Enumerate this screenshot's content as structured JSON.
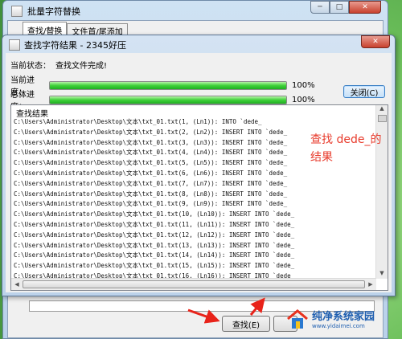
{
  "main_window": {
    "title": "批量字符替换",
    "tabs": [
      "查找/替换",
      "文件首/尾添加"
    ],
    "find_button_label": "查找(E)"
  },
  "dialog": {
    "title": "查找字符结果 - 2345好压",
    "status_label": "当前状态：",
    "status_value": "查找文件完成!",
    "current_progress_label": "当前进度：",
    "current_progress_value": 1.0,
    "current_progress_text": "100%",
    "total_progress_label": "总体进度：",
    "total_progress_value": 1.0,
    "total_progress_text": "100%",
    "close_button_label": "关闭(C)",
    "results_header": "查找结果",
    "results": [
      "C:\\Users\\Administrator\\Desktop\\文本\\txt_01.txt(1, (Ln1)): INTO `dede_",
      "C:\\Users\\Administrator\\Desktop\\文本\\txt_01.txt(2, (Ln2)): INSERT INTO `dede_",
      "C:\\Users\\Administrator\\Desktop\\文本\\txt_01.txt(3, (Ln3)): INSERT INTO `dede_",
      "C:\\Users\\Administrator\\Desktop\\文本\\txt_01.txt(4, (Ln4)): INSERT INTO `dede_",
      "C:\\Users\\Administrator\\Desktop\\文本\\txt_01.txt(5, (Ln5)): INSERT INTO `dede_",
      "C:\\Users\\Administrator\\Desktop\\文本\\txt_01.txt(6, (Ln6)): INSERT INTO `dede_",
      "C:\\Users\\Administrator\\Desktop\\文本\\txt_01.txt(7, (Ln7)): INSERT INTO `dede_",
      "C:\\Users\\Administrator\\Desktop\\文本\\txt_01.txt(8, (Ln8)): INSERT INTO `dede_",
      "C:\\Users\\Administrator\\Desktop\\文本\\txt_01.txt(9, (Ln9)): INSERT INTO `dede_",
      "C:\\Users\\Administrator\\Desktop\\文本\\txt_01.txt(10, (Ln10)): INSERT INTO `dede_",
      "C:\\Users\\Administrator\\Desktop\\文本\\txt_01.txt(11, (Ln11)): INSERT INTO `dede_",
      "C:\\Users\\Administrator\\Desktop\\文本\\txt_01.txt(12, (Ln12)): INSERT INTO `dede_",
      "C:\\Users\\Administrator\\Desktop\\文本\\txt_01.txt(13, (Ln13)): INSERT INTO `dede_",
      "C:\\Users\\Administrator\\Desktop\\文本\\txt_01.txt(14, (Ln14)): INSERT INTO `dede_",
      "C:\\Users\\Administrator\\Desktop\\文本\\txt_01.txt(15, (Ln15)): INSERT INTO `dede_",
      "C:\\Users\\Administrator\\Desktop\\文本\\txt_01.txt(16, (Ln16)): INSERT INTO `dede_"
    ]
  },
  "annotation": {
    "text": "查找 dede_的结果",
    "color": "#e83b2c"
  },
  "watermark": {
    "title": "纯净系统家园",
    "url": "www.yidaimei.com"
  },
  "icons": {
    "window_controls": [
      "minimize-icon",
      "maximize-icon",
      "close-icon"
    ],
    "scroll": [
      "scroll-up-icon",
      "scroll-down-icon",
      "scroll-left-icon",
      "scroll-right-icon"
    ]
  }
}
